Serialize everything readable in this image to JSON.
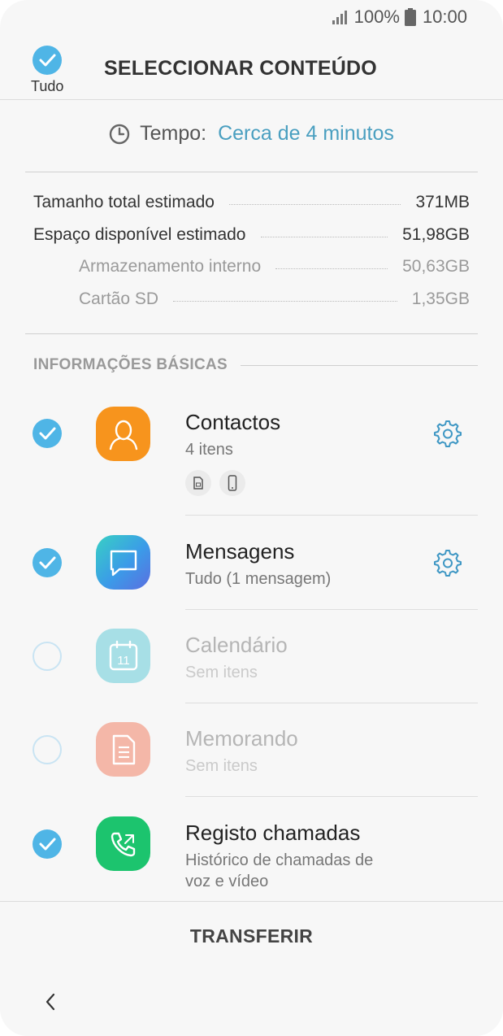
{
  "status": {
    "battery_pct": "100%",
    "time": "10:00"
  },
  "header": {
    "select_all_label": "Tudo",
    "title": "SELECCIONAR CONTEÚDO"
  },
  "time_estimate": {
    "label": "Tempo:",
    "value": "Cerca de 4 minutos"
  },
  "storage": [
    {
      "label": "Tamanho total estimado",
      "value": "371MB"
    },
    {
      "label": "Espaço disponível estimado",
      "value": "51,98GB"
    },
    {
      "label": "Armazenamento interno",
      "value": "50,63GB"
    },
    {
      "label": "Cartão SD",
      "value": "1,35GB"
    }
  ],
  "section_title": "INFORMAÇÕES BÁSICAS",
  "items": [
    {
      "title": "Contactos",
      "subtitle": "4 itens",
      "checked": true,
      "enabled": true,
      "icon": "contacts-icon",
      "color": "#f7941d",
      "has_settings": true
    },
    {
      "title": "Mensagens",
      "subtitle": "Tudo (1 mensagem)",
      "checked": true,
      "enabled": true,
      "icon": "messages-icon",
      "color": "#3ea6e8",
      "has_settings": true
    },
    {
      "title": "Calendário",
      "subtitle": "Sem itens",
      "checked": false,
      "enabled": false,
      "icon": "calendar-icon",
      "color": "#a7dfe6",
      "has_settings": false
    },
    {
      "title": "Memorando",
      "subtitle": "Sem itens",
      "checked": false,
      "enabled": false,
      "icon": "memo-icon",
      "color": "#f4b7a8",
      "has_settings": false
    },
    {
      "title": "Registo chamadas",
      "subtitle_line1": "Histórico de chamadas de",
      "subtitle_line2": "voz e vídeo",
      "checked": true,
      "enabled": true,
      "icon": "call-log-icon",
      "color": "#1cc46e",
      "has_settings": false
    }
  ],
  "contacts_sources": [
    "sim-card-icon",
    "phone-icon"
  ],
  "bottom": {
    "transfer_label": "TRANSFERIR"
  },
  "colors": {
    "accent": "#4fb5e6",
    "time_value": "#4a9fc0"
  }
}
